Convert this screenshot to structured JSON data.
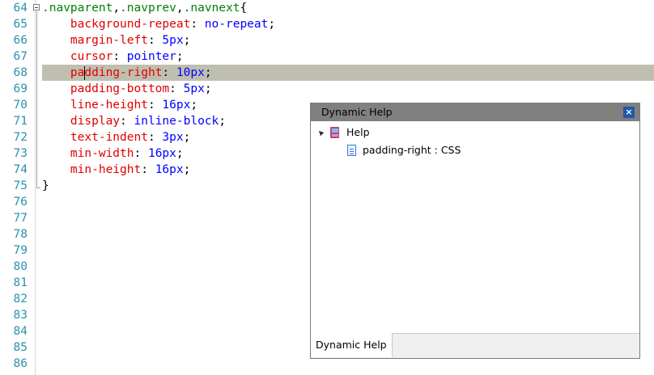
{
  "editor": {
    "lines": [
      {
        "num": "64",
        "parts": [
          {
            "t": ".navparent",
            "c": "sel"
          },
          {
            "t": ",",
            "c": "pun"
          },
          {
            "t": ".navprev",
            "c": "sel"
          },
          {
            "t": ",",
            "c": "pun"
          },
          {
            "t": ".navnext",
            "c": "sel"
          },
          {
            "t": "{",
            "c": "pun"
          }
        ]
      },
      {
        "num": "65",
        "parts": [
          {
            "t": "    background-repeat",
            "c": "prop"
          },
          {
            "t": ": ",
            "c": "pun"
          },
          {
            "t": "no-repeat",
            "c": "val"
          },
          {
            "t": ";",
            "c": "pun"
          }
        ]
      },
      {
        "num": "66",
        "parts": [
          {
            "t": "    margin-left",
            "c": "prop"
          },
          {
            "t": ": ",
            "c": "pun"
          },
          {
            "t": "5px",
            "c": "val"
          },
          {
            "t": ";",
            "c": "pun"
          }
        ]
      },
      {
        "num": "67",
        "parts": [
          {
            "t": "    cursor",
            "c": "prop"
          },
          {
            "t": ": ",
            "c": "pun"
          },
          {
            "t": "pointer",
            "c": "val"
          },
          {
            "t": ";",
            "c": "pun"
          }
        ]
      },
      {
        "num": "68",
        "highlighted": true,
        "parts": [
          {
            "t": "    pa",
            "c": "prop"
          },
          {
            "caret": true
          },
          {
            "t": "dding-right",
            "c": "prop"
          },
          {
            "t": ": ",
            "c": "pun"
          },
          {
            "t": "10px",
            "c": "val"
          },
          {
            "t": ";",
            "c": "pun"
          }
        ]
      },
      {
        "num": "69",
        "parts": [
          {
            "t": "    padding-bottom",
            "c": "prop"
          },
          {
            "t": ": ",
            "c": "pun"
          },
          {
            "t": "5px",
            "c": "val"
          },
          {
            "t": ";",
            "c": "pun"
          }
        ]
      },
      {
        "num": "70",
        "parts": [
          {
            "t": "    line-height",
            "c": "prop"
          },
          {
            "t": ": ",
            "c": "pun"
          },
          {
            "t": "16px",
            "c": "val"
          },
          {
            "t": ";",
            "c": "pun"
          }
        ]
      },
      {
        "num": "71",
        "parts": [
          {
            "t": "    display",
            "c": "prop"
          },
          {
            "t": ": ",
            "c": "pun"
          },
          {
            "t": "inline-block",
            "c": "val"
          },
          {
            "t": ";",
            "c": "pun"
          }
        ]
      },
      {
        "num": "72",
        "parts": [
          {
            "t": "    text-indent",
            "c": "prop"
          },
          {
            "t": ": ",
            "c": "pun"
          },
          {
            "t": "3px",
            "c": "val"
          },
          {
            "t": ";",
            "c": "pun"
          }
        ]
      },
      {
        "num": "73",
        "parts": [
          {
            "t": "    min-width",
            "c": "prop"
          },
          {
            "t": ": ",
            "c": "pun"
          },
          {
            "t": "16px",
            "c": "val"
          },
          {
            "t": ";",
            "c": "pun"
          }
        ]
      },
      {
        "num": "74",
        "parts": [
          {
            "t": "    min-height",
            "c": "prop"
          },
          {
            "t": ": ",
            "c": "pun"
          },
          {
            "t": "16px",
            "c": "val"
          },
          {
            "t": ";",
            "c": "pun"
          }
        ]
      },
      {
        "num": "75",
        "parts": [
          {
            "t": "}",
            "c": "pun"
          }
        ]
      },
      {
        "num": "76",
        "parts": []
      },
      {
        "num": "77",
        "parts": []
      },
      {
        "num": "78",
        "parts": []
      },
      {
        "num": "79",
        "parts": []
      },
      {
        "num": "80",
        "parts": []
      },
      {
        "num": "81",
        "parts": []
      },
      {
        "num": "82",
        "parts": []
      },
      {
        "num": "83",
        "parts": []
      },
      {
        "num": "84",
        "parts": []
      },
      {
        "num": "85",
        "parts": []
      },
      {
        "num": "86",
        "parts": []
      }
    ]
  },
  "dynamic_help": {
    "title": "Dynamic Help",
    "close_icon": "close-icon",
    "tree": {
      "root_label": "Help",
      "root_icon": "book-icon",
      "child_label": "padding-right : CSS",
      "child_icon": "page-icon"
    },
    "tab_label": "Dynamic Help"
  }
}
